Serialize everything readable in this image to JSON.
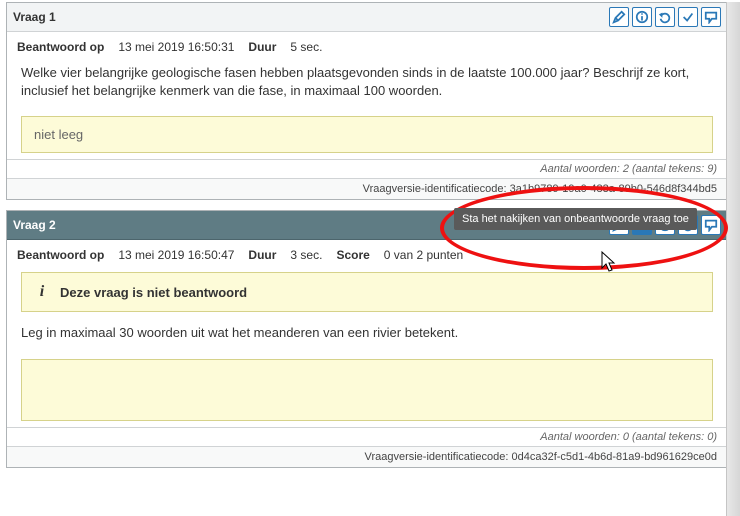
{
  "q1": {
    "title": "Vraag 1",
    "answered_label": "Beantwoord op",
    "answered_at": "13 mei 2019 16:50:31",
    "duration_label": "Duur",
    "duration_value": "5 sec.",
    "question_text": "Welke vier belangrijke geologische fasen hebben plaatsgevonden sinds in de laatste 100.000 jaar? Beschrijf ze kort, inclusief het belangrijke kenmerk van die fase, in maximaal 100 woorden.",
    "answer_text": "niet leeg",
    "counts_text": "Aantal woorden: 2 (aantal tekens: 9)",
    "id_label": "Vraagversie-identificatiecode:",
    "id_value": "3a1b9789-19a0-483a-89b0-546d8f344bd5"
  },
  "q2": {
    "title": "Vraag 2",
    "answered_label": "Beantwoord op",
    "answered_at": "13 mei 2019 16:50:47",
    "duration_label": "Duur",
    "duration_value": "3 sec.",
    "score_label": "Score",
    "score_value": "0 van 2 punten",
    "warning_text": "Deze vraag is niet beantwoord",
    "question_text": "Leg in maximaal 30 woorden uit wat het meanderen van een rivier betekent.",
    "answer_text": "",
    "counts_text": "Aantal woorden: 0 (aantal tekens: 0)",
    "id_label": "Vraagversie-identificatiecode:",
    "id_value": "0d4ca32f-c5d1-4b6d-81a9-bd961629ce0d"
  },
  "tooltip_text": "Sta het nakijken van onbeantwoorde vraag toe",
  "icons": {
    "edit": "edit-icon",
    "info": "info-icon",
    "undo": "undo-icon",
    "check": "check-icon",
    "comment": "comment-icon"
  }
}
